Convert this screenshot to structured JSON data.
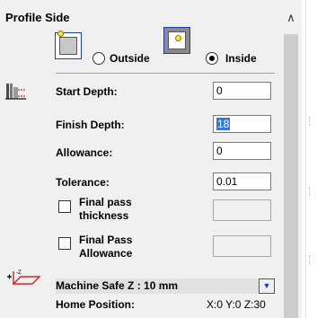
{
  "title": "Profile Side",
  "profile_side": {
    "outside_label": "Outside",
    "inside_label": "Inside",
    "selected": "inside"
  },
  "fields": {
    "start_depth": {
      "label": "Start Depth:",
      "value": "0"
    },
    "finish_depth": {
      "label": "Finish Depth:",
      "value": "18"
    },
    "allowance": {
      "label": "Allowance:",
      "value": "0"
    },
    "tolerance": {
      "label": "Tolerance:",
      "value": "0.01"
    }
  },
  "final_pass_thickness": {
    "line1": "Final pass",
    "line2": "thickness",
    "checked": false
  },
  "final_pass_allowance": {
    "line1": "Final Pass",
    "line2": "Allowance",
    "checked": false
  },
  "safe_z": {
    "label": "Machine Safe Z : 10 mm"
  },
  "home_position": {
    "label": "Home Position:",
    "value": "X:0 Y:0 Z:30"
  },
  "icons": {
    "outside": "profile-outside-icon",
    "inside": "profile-inside-icon",
    "depth": "cut-depth-icon",
    "safe_z": "safe-z-icon",
    "scroll_up": "chevron-up-icon",
    "dropdown": "dropdown-arrow-icon"
  },
  "colors": {
    "selection": "#3478d8",
    "icon_border": "#1d3fa8",
    "icon_dot": "#f4e63a"
  }
}
